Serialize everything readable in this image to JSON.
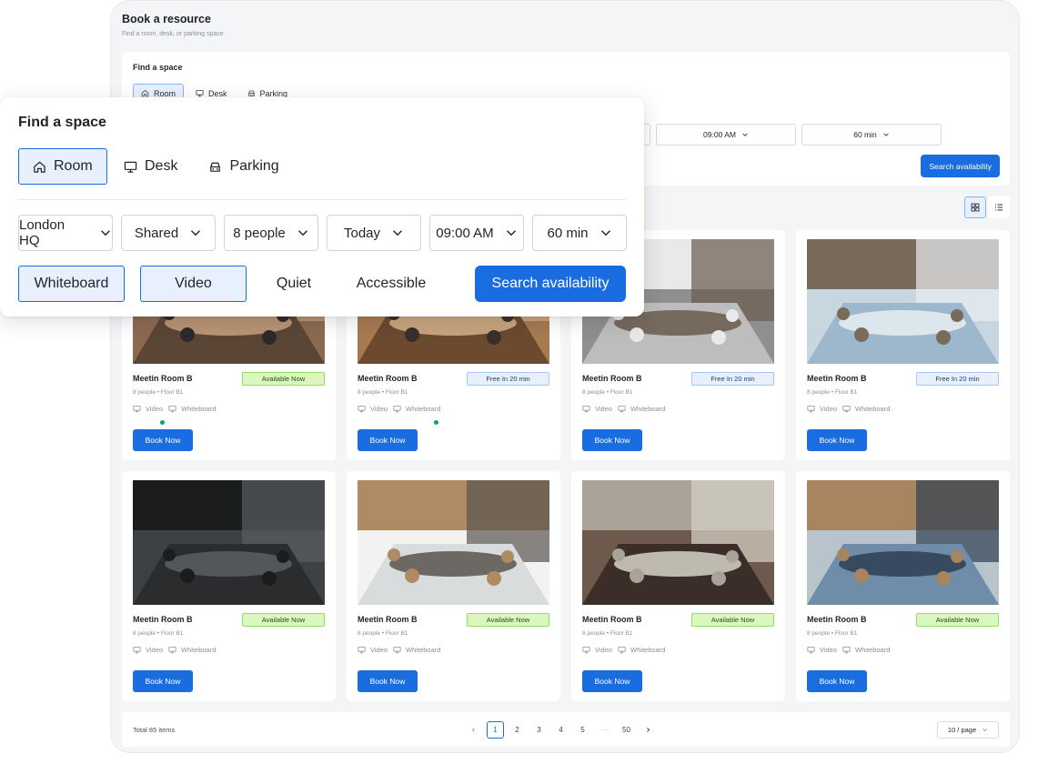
{
  "header": {
    "title": "Book a resource",
    "subtitle": "Find a room, desk, or parking space"
  },
  "search_panel": {
    "title": "Find a space",
    "tabs": [
      {
        "label": "Room",
        "icon": "home-icon",
        "active": true
      },
      {
        "label": "Desk",
        "icon": "monitor-icon",
        "active": false
      },
      {
        "label": "Parking",
        "icon": "car-icon",
        "active": false
      }
    ],
    "selects": [
      "London HQ",
      "Shared",
      "8 people",
      "Today",
      "09:00 AM",
      "60 min"
    ],
    "chips": [
      {
        "label": "Whiteboard",
        "active": true
      },
      {
        "label": "Video",
        "active": true
      },
      {
        "label": "Quiet",
        "active": false
      },
      {
        "label": "Accessible",
        "active": false
      }
    ],
    "search_label": "Search availability"
  },
  "bg_panel": {
    "selects": [
      "09:00 AM",
      "60 min"
    ]
  },
  "view": {
    "grid_active": true
  },
  "cards": [
    {
      "name": "Meetin Room B",
      "meta": "8 people • Floor B1",
      "status": "Available Now",
      "status_type": "green",
      "amenities": [
        "Video",
        "Whiteboard"
      ],
      "book": "Book Now",
      "dot": true
    },
    {
      "name": "Meetin Room B",
      "meta": "8 people • Floor B1",
      "status": "Free In 20 min",
      "status_type": "blue",
      "amenities": [
        "Video",
        "Whiteboard"
      ],
      "book": "Book Now",
      "dot": true
    },
    {
      "name": "Meetin Room B",
      "meta": "8 people • Floor B1",
      "status": "Free In 20 min",
      "status_type": "blue",
      "amenities": [
        "Video",
        "Whiteboard"
      ],
      "book": "Book Now",
      "dot": false
    },
    {
      "name": "Meetin Room B",
      "meta": "8 people • Floor B1",
      "status": "Free In 20 min",
      "status_type": "blue",
      "amenities": [
        "Video",
        "Whiteboard"
      ],
      "book": "Book Now",
      "dot": false
    },
    {
      "name": "Meetin Room B",
      "meta": "8 people • Floor B1",
      "status": "Available Now",
      "status_type": "green",
      "amenities": [
        "Video",
        "Whiteboard"
      ],
      "book": "Book Now",
      "dot": false
    },
    {
      "name": "Meetin Room B",
      "meta": "8 people • Floor B1",
      "status": "Available Now",
      "status_type": "green",
      "amenities": [
        "Video",
        "Whiteboard"
      ],
      "book": "Book Now",
      "dot": false
    },
    {
      "name": "Meetin Room B",
      "meta": "8 people • Floor B1",
      "status": "Available Now",
      "status_type": "green",
      "amenities": [
        "Video",
        "Whiteboard"
      ],
      "book": "Book Now",
      "dot": false
    },
    {
      "name": "Meetin Room B",
      "meta": "8 people • Floor B1",
      "status": "Available Now",
      "status_type": "green",
      "amenities": [
        "Video",
        "Whiteboard"
      ],
      "book": "Book Now",
      "dot": false
    }
  ],
  "footer": {
    "total": "Total 85 items",
    "pages": [
      "1",
      "2",
      "3",
      "4",
      "5",
      "···",
      "50"
    ],
    "current_page": "1",
    "page_size": "10 / page"
  },
  "colors": {
    "primary": "#1a6de0",
    "available_bg": "#d9f7be",
    "free_bg": "#e6f0ff",
    "app_bg": "#f4f5f7"
  }
}
